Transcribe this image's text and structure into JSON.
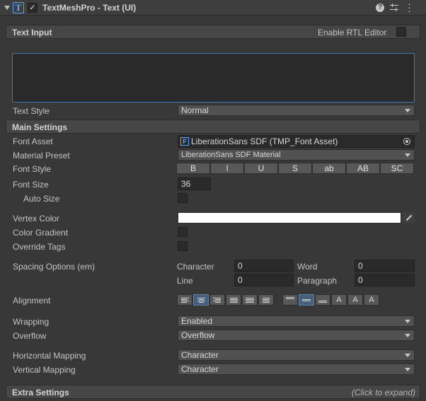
{
  "component": {
    "title": "TextMeshPro - Text (UI)",
    "enabled": true,
    "icon_name": "tmp-text-icon",
    "header_icons": [
      "help-icon",
      "preset-icon",
      "more-icon"
    ]
  },
  "text_input": {
    "section_label": "Text Input",
    "rtl_label": "Enable RTL Editor",
    "text_value": "",
    "text_style_label": "Text Style",
    "text_style_value": "Normal"
  },
  "main_settings": {
    "section_label": "Main Settings",
    "font_asset_label": "Font Asset",
    "font_asset_value": "LiberationSans SDF (TMP_Font Asset)",
    "material_preset_label": "Material Preset",
    "material_preset_value": "LiberationSans SDF Material",
    "font_style_label": "Font Style",
    "font_style_buttons": [
      "B",
      "I",
      "U",
      "S",
      "ab",
      "AB",
      "SC"
    ],
    "font_size_label": "Font Size",
    "font_size_value": "36",
    "auto_size_label": "Auto Size",
    "vertex_color_label": "Vertex Color",
    "vertex_color": "#ffffff",
    "color_gradient_label": "Color Gradient",
    "override_tags_label": "Override Tags",
    "spacing_label": "Spacing Options (em)",
    "spacing": {
      "character_label": "Character",
      "character_value": "0",
      "word_label": "Word",
      "word_value": "0",
      "line_label": "Line",
      "line_value": "0",
      "paragraph_label": "Paragraph",
      "paragraph_value": "0"
    },
    "alignment_label": "Alignment",
    "alignment_selected": [
      "center",
      "middle"
    ],
    "wrapping_label": "Wrapping",
    "wrapping_value": "Enabled",
    "overflow_label": "Overflow",
    "overflow_value": "Overflow",
    "horizontal_mapping_label": "Horizontal Mapping",
    "horizontal_mapping_value": "Character",
    "vertical_mapping_label": "Vertical Mapping",
    "vertical_mapping_value": "Character"
  },
  "extra_settings": {
    "section_label": "Extra Settings",
    "expand_hint": "(Click to expand)"
  },
  "colors": {
    "panel_bg": "#383838",
    "focus_border": "#3a79bb",
    "selected_button": "#46607c"
  }
}
